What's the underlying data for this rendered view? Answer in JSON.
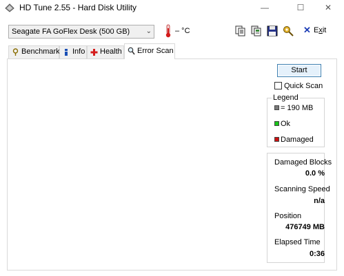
{
  "window": {
    "title": "HD Tune 2.55 - Hard Disk Utility",
    "minimize": "—",
    "maximize": "☐",
    "close": "✕"
  },
  "toolbar": {
    "drive": "Seagate FA GoFlex Desk (500 GB)",
    "temperature": "– °C",
    "exit_prefix": "E",
    "exit_underlined": "x",
    "exit_suffix": "it"
  },
  "tabs": [
    {
      "label": "Benchmark",
      "active": false
    },
    {
      "label": "Info",
      "active": false
    },
    {
      "label": "Health",
      "active": false
    },
    {
      "label": "Error Scan",
      "active": true
    }
  ],
  "scan": {
    "start_label": "Start",
    "quick_scan_label": "Quick Scan",
    "quick_scan_checked": false,
    "grid_columns": 58,
    "grid_rows": 44,
    "block_status": "ok"
  },
  "legend": {
    "title": "Legend",
    "items": [
      {
        "label": "= 190 MB",
        "color": "#7a7a7a"
      },
      {
        "label": "Ok",
        "color": "#19c619"
      },
      {
        "label": "Damaged",
        "color": "#cc1111"
      }
    ]
  },
  "stats": {
    "damaged_blocks_label": "Damaged Blocks",
    "damaged_blocks_value": "0.0 %",
    "scanning_speed_label": "Scanning Speed",
    "scanning_speed_value": "n/a",
    "position_label": "Position",
    "position_value": "476749 MB",
    "elapsed_label": "Elapsed Time",
    "elapsed_value": "0:36"
  },
  "colors": {
    "ok_block": "#19c619",
    "grid_lines": "#1a7f1a",
    "exit_accent": "#1a3bb5"
  }
}
